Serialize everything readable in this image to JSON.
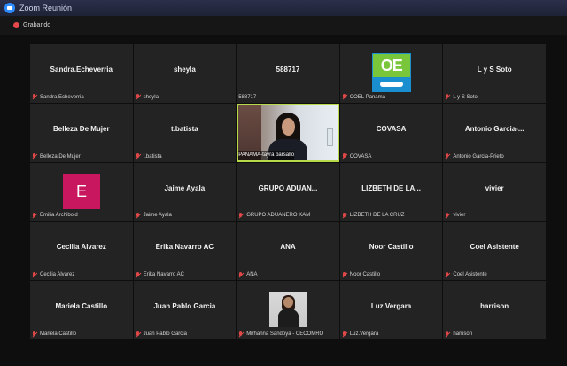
{
  "window": {
    "title": "Zoom Reunión"
  },
  "recording": {
    "label": "Grabando"
  },
  "participants": [
    {
      "display": "Sandra.Echeverria",
      "label": "Sandra.Echeverria",
      "muted": true
    },
    {
      "display": "sheyla",
      "label": "sheyla",
      "muted": true
    },
    {
      "display": "588717",
      "label": "588717",
      "muted": false
    },
    {
      "display": "",
      "label": "COEL Panamá",
      "muted": true,
      "image": "coel-logo",
      "logo_text": "OE"
    },
    {
      "display": "L y S Soto",
      "label": "L y S Soto",
      "muted": true
    },
    {
      "display": "Belleza De Mujer",
      "label": "Belleza De Mujer",
      "muted": true
    },
    {
      "display": "t.batista",
      "label": "t.batista",
      "muted": true
    },
    {
      "display": "",
      "label": "PANAMA-tayra barsallo",
      "muted": false,
      "video": true,
      "active_speaker": true
    },
    {
      "display": "COVASA",
      "label": "COVASA",
      "muted": true
    },
    {
      "display": "Antonio Garcia-...",
      "label": "Antonio Garcia-Prieto",
      "muted": true
    },
    {
      "display": "",
      "label": "Emilia Archibold",
      "muted": true,
      "image": "avatar-letter",
      "avatar_letter": "E",
      "avatar_color": "#c8175f"
    },
    {
      "display": "Jaime Ayala",
      "label": "Jaime Ayala",
      "muted": true
    },
    {
      "display": "GRUPO ADUAN...",
      "label": "GRUPO ADUANERO KAM",
      "muted": true
    },
    {
      "display": "LIZBETH DE LA...",
      "label": "LIZBETH DE LA CRUZ",
      "muted": true
    },
    {
      "display": "vivier",
      "label": "vivier",
      "muted": true
    },
    {
      "display": "Cecilia Alvarez",
      "label": "Cecilia Alvarez",
      "muted": true
    },
    {
      "display": "Erika Navarro AC",
      "label": "Erika Navarro AC",
      "muted": true
    },
    {
      "display": "ANA",
      "label": "ANA",
      "muted": true
    },
    {
      "display": "Noor Castillo",
      "label": "Noor Castillo",
      "muted": true
    },
    {
      "display": "Coel Asistente",
      "label": "Coel Asistente",
      "muted": true
    },
    {
      "display": "Mariela Castillo",
      "label": "Mariela Castillo",
      "muted": true
    },
    {
      "display": "Juan Pablo Garcia",
      "label": "Juan Pablo Garcia",
      "muted": true
    },
    {
      "display": "",
      "label": "Mirhanna Sandoya - CECOMRO",
      "muted": true,
      "image": "profile-photo"
    },
    {
      "display": "Luz.Vergara",
      "label": "Luz.Vergara",
      "muted": true
    },
    {
      "display": "harrison",
      "label": "harrison",
      "muted": true
    }
  ]
}
